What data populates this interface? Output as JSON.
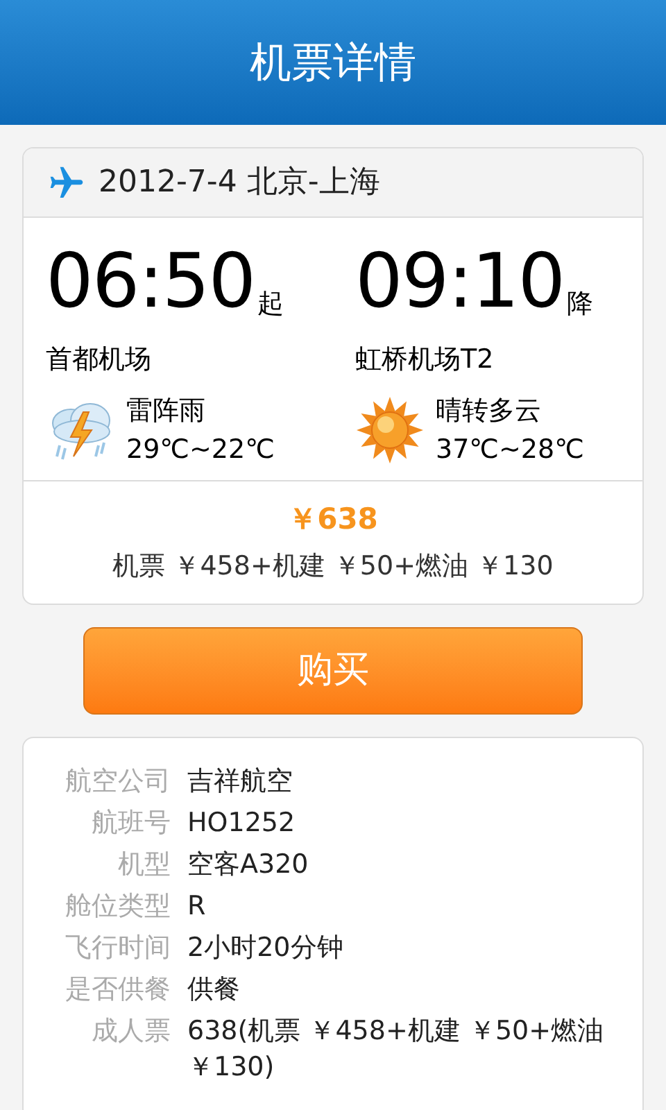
{
  "header": {
    "title": "机票详情"
  },
  "flight": {
    "route": "2012-7-4 北京-上海",
    "ends": [
      {
        "time": "06:50",
        "mark": "起",
        "airport": "首都机场",
        "weather": {
          "kind": "storm",
          "text": "雷阵雨",
          "temp": "29℃~22℃"
        }
      },
      {
        "time": "09:10",
        "mark": "降",
        "airport": "虹桥机场T2",
        "weather": {
          "kind": "sunny",
          "text": "晴转多云",
          "temp": "37℃~28℃"
        }
      }
    ],
    "price": "￥638",
    "breakdown": "机票 ￥458+机建 ￥50+燃油 ￥130"
  },
  "buy_button": "购买",
  "details": [
    {
      "label": "航空公司",
      "value": "吉祥航空"
    },
    {
      "label": "航班号",
      "value": "HO1252"
    },
    {
      "label": "机型",
      "value": "空客A320"
    },
    {
      "label": "舱位类型",
      "value": "R"
    },
    {
      "label": "飞行时间",
      "value": "2小时20分钟"
    },
    {
      "label": "是否供餐",
      "value": "供餐"
    },
    {
      "label": "成人票",
      "value": "638(机票 ￥458+机建 ￥50+燃油￥130)"
    }
  ]
}
